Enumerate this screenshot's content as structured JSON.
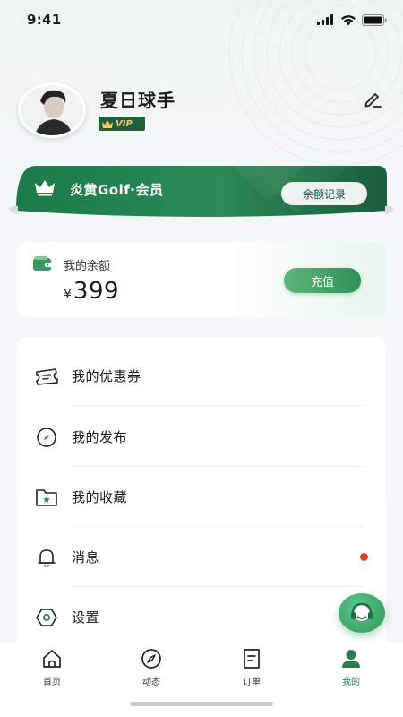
{
  "status_bar": {
    "time": "9:41"
  },
  "profile": {
    "name": "夏日球手",
    "vip_label": "VIP"
  },
  "member_banner": {
    "title": "炎黄Golf·会员",
    "record_button": "余额记录"
  },
  "balance": {
    "label": "我的余额",
    "currency": "¥",
    "amount": "399",
    "recharge_button": "充值"
  },
  "menu": [
    {
      "label": "我的优惠券",
      "icon": "coupon-icon"
    },
    {
      "label": "我的发布",
      "icon": "compass-icon"
    },
    {
      "label": "我的收藏",
      "icon": "folder-star-icon"
    },
    {
      "label": "消息",
      "icon": "bell-icon",
      "unread": true
    },
    {
      "label": "设置",
      "icon": "settings-icon"
    }
  ],
  "tabs": [
    {
      "label": "首页",
      "icon": "home-icon"
    },
    {
      "label": "动态",
      "icon": "compass-icon"
    },
    {
      "label": "订单",
      "icon": "order-icon"
    },
    {
      "label": "我的",
      "icon": "user-icon",
      "active": true
    }
  ],
  "colors": {
    "brand_green": "#1f6b45",
    "accent_green": "#2e8f56",
    "unread_dot": "#d9412b"
  }
}
